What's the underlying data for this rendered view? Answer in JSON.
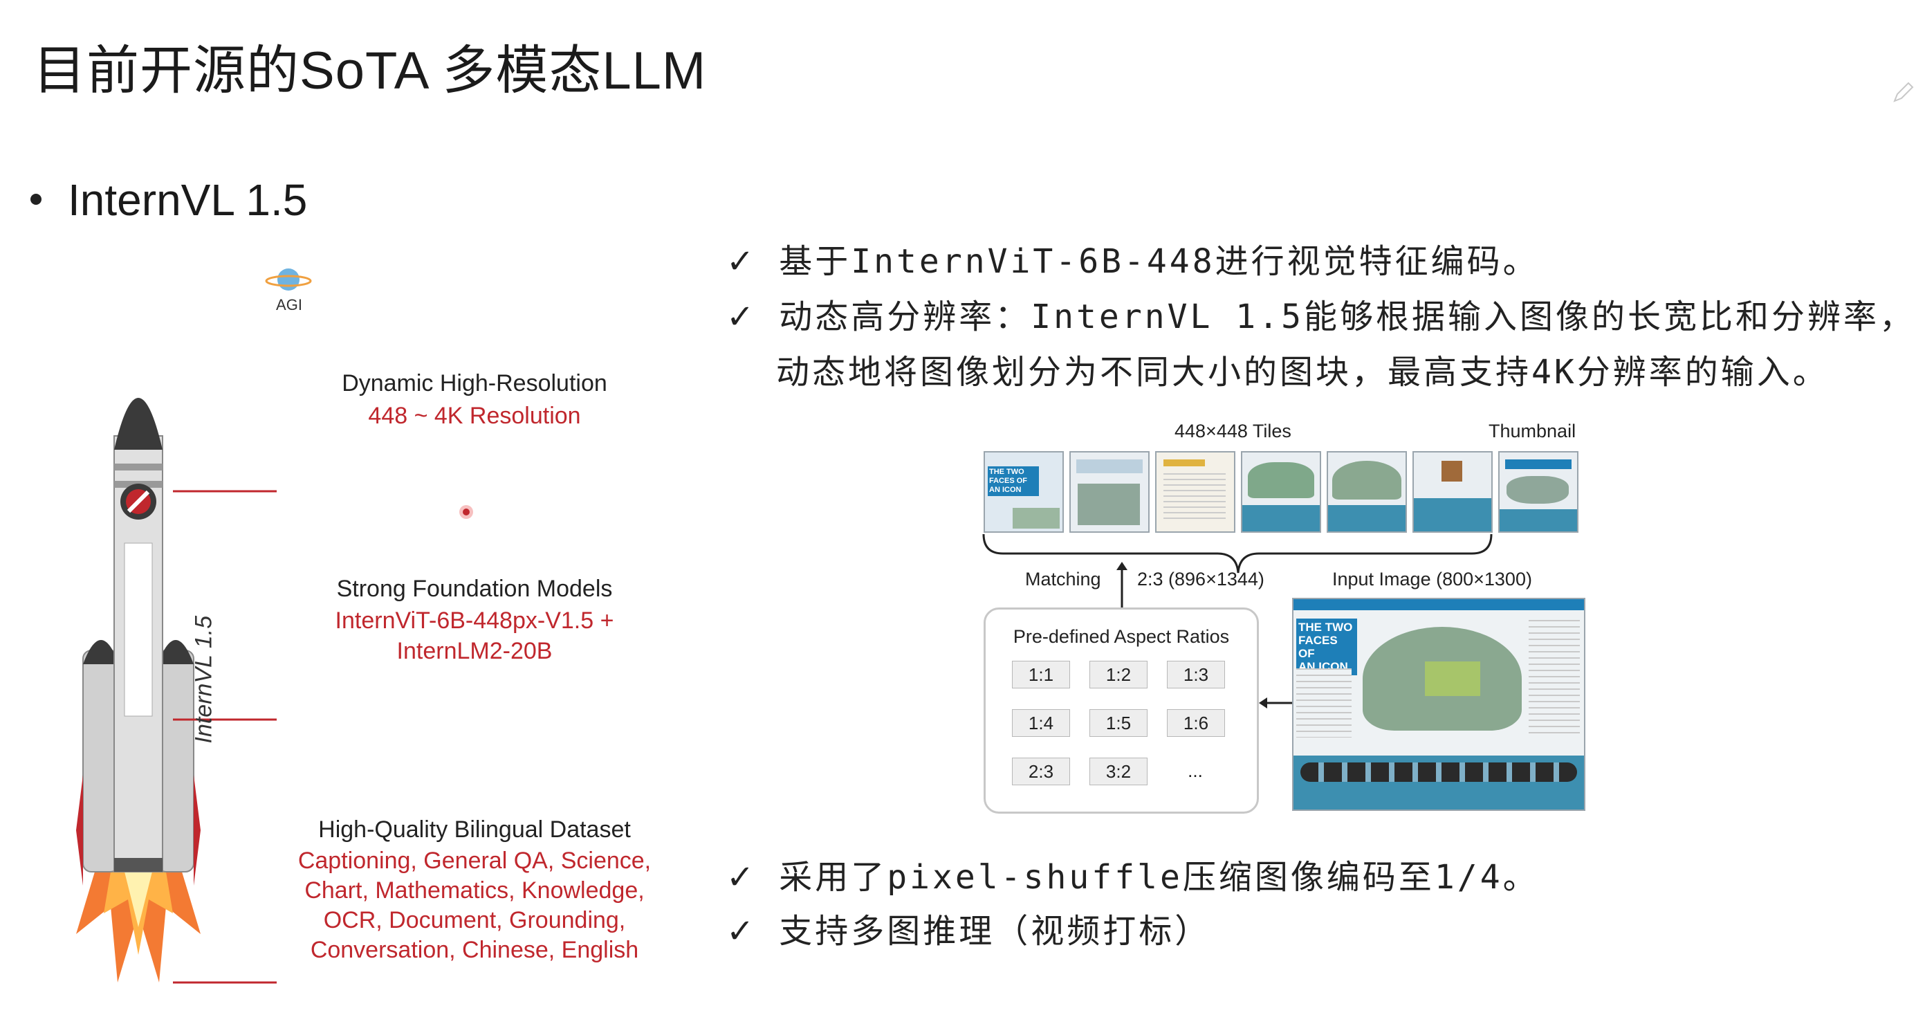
{
  "slide": {
    "title": "目前开源的SoTA 多模态LLM",
    "bullet": "InternVL 1.5"
  },
  "checklist_top": [
    {
      "tick": "✓",
      "text": "基于InternViT-6B-448进行视觉特征编码。"
    },
    {
      "tick": "✓",
      "text": "动态高分辨率：InternVL 1.5能够根据输入图像的长宽比和分辨率，",
      "continuation": "动态地将图像划分为不同大小的图块，最高支持4K分辨率的输入。"
    }
  ],
  "checklist_bottom": [
    {
      "tick": "✓",
      "text": "采用了pixel-shuffle压缩图像编码至1/4。"
    },
    {
      "tick": "✓",
      "text": "支持多图推理（视频打标）"
    }
  ],
  "rocket_figure": {
    "top_badge": "AGI",
    "rocket_label": "InternVL 1.5",
    "features": [
      {
        "title": "Dynamic High-Resolution",
        "detail_lines": [
          "448 ~ 4K Resolution"
        ]
      },
      {
        "title": "Strong Foundation Models",
        "detail_lines": [
          "InternViT-6B-448px-V1.5 +",
          "InternLM2-20B"
        ]
      },
      {
        "title": "High-Quality Bilingual Dataset",
        "detail_lines": [
          "Captioning, General QA, Science,",
          "Chart, Mathematics, Knowledge,",
          "OCR, Document, Grounding,",
          "Conversation, Chinese, English"
        ]
      }
    ],
    "colors": {
      "accent_red": "#c0272d",
      "rocket_body": "#d9d9d9",
      "rocket_dark": "#3a3a3a",
      "flame": "#f26b1d"
    }
  },
  "tiles_figure": {
    "tiles_label": "448×448 Tiles",
    "thumbnail_label": "Thumbnail",
    "matching_label": "Matching",
    "matched_ratio": "2:3 (896×1344)",
    "input_label": "Input Image (800×1300)",
    "tile_overlay_text": [
      "THE TWO",
      "FACES OF",
      "AN ICON"
    ],
    "input_overlay_text": [
      "THE TWO",
      "FACES OF",
      "AN ICON"
    ],
    "box_title": "Pre-defined Aspect Ratios",
    "aspect_ratios": [
      "1:1",
      "1:2",
      "1:3",
      "1:4",
      "1:5",
      "1:6",
      "2:3",
      "3:2",
      "..."
    ]
  }
}
